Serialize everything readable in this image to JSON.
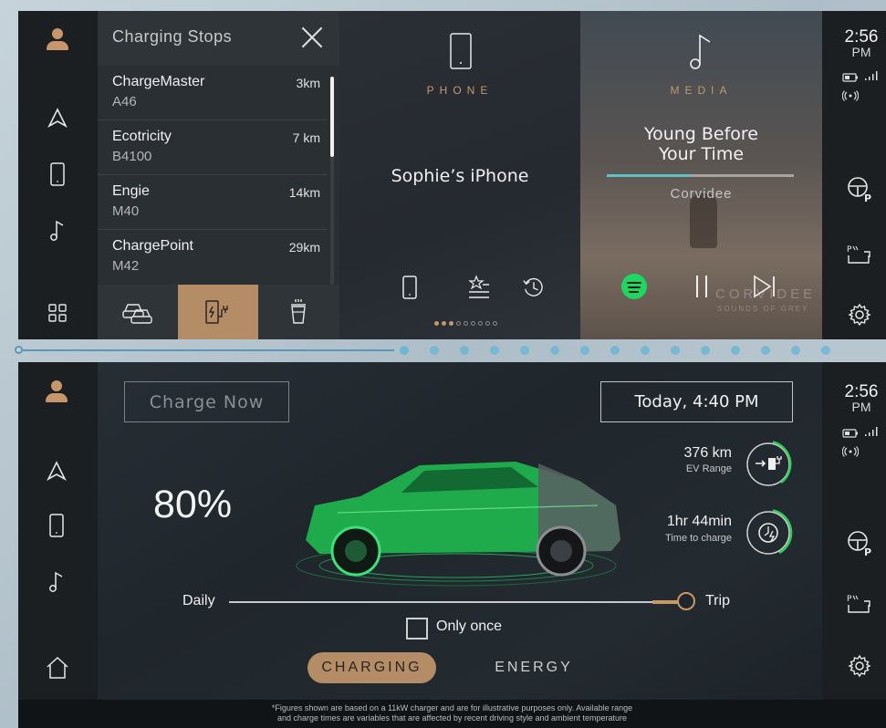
{
  "colors": {
    "accent_copper": "#b48c66",
    "accent_cyan": "#5fc3c6",
    "gauge_green": "#2fcf5a",
    "spotify_green": "#1ed760",
    "pager_blue": "#6eb6d4"
  },
  "status": {
    "time": "2:56",
    "ampm": "PM"
  },
  "left_rail_icons": [
    "avatar-icon",
    "navigation-icon",
    "phone-icon",
    "music-note-icon",
    "apps-grid-icon",
    "home-icon"
  ],
  "right_rail_icons": [
    "battery-icon",
    "signal-icon",
    "broadcast-icon",
    "steering-wheel-park-icon",
    "park-assist-icon",
    "settings-gear-icon"
  ],
  "charging_stops": {
    "title": "Charging Stops",
    "items": [
      {
        "name": "ChargeMaster",
        "road": "A46",
        "distance": "3km"
      },
      {
        "name": "Ecotricity",
        "road": "B4100",
        "distance": "7 km"
      },
      {
        "name": "Engie",
        "road": "M40",
        "distance": "14km"
      },
      {
        "name": "ChargePoint",
        "road": "M42",
        "distance": "29km"
      }
    ],
    "filter_tabs": [
      "nearby-cars-icon",
      "charger-plug-icon",
      "coffee-icon"
    ],
    "active_filter": 1
  },
  "phone": {
    "label": "PHONE",
    "device": "Sophie’s iPhone",
    "actions": [
      "handset-icon",
      "favourites-icon",
      "recent-calls-icon"
    ]
  },
  "pager": {
    "total": 9,
    "active": 3
  },
  "media": {
    "label": "MEDIA",
    "track_line1": "Young Before",
    "track_line2": "Your Time",
    "artist": "Corvidee",
    "progress": 0.45,
    "art_text": "CORVIDEE",
    "art_subtext": "SOUNDS OF GREY"
  },
  "screen_pager": {
    "total": 15,
    "active": 0
  },
  "charging": {
    "charge_now": "Charge Now",
    "schedule": "Today, 4:40 PM",
    "percent": "80%",
    "range_value": "376 km",
    "range_label": "EV Range",
    "time_value": "1hr 44min",
    "time_label": "Time to charge",
    "slider_left": "Daily",
    "slider_right": "Trip",
    "slider_position": "trip",
    "only_once": "Only once",
    "only_once_checked": false,
    "tabs": [
      "CHARGING",
      "ENERGY"
    ],
    "active_tab": "CHARGING",
    "footnote_line1": "*Figures shown are based on a 11kW charger and are for illustrative purposes only.  Available range",
    "footnote_line2": "and charge times are variables that are affected by recent driving style and ambient temperature"
  }
}
